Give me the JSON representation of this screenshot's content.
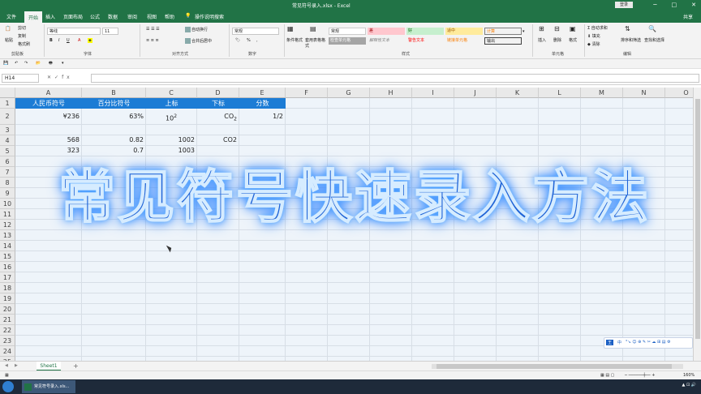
{
  "window": {
    "title": "常见符号录入.xlsx  -  Excel",
    "login": "登录",
    "min": "─",
    "max": "□",
    "close": "✕"
  },
  "ribbon_tabs": [
    "文件",
    "开始",
    "插入",
    "页面布局",
    "公式",
    "数据",
    "审阅",
    "视图",
    "帮助",
    "操作说明搜索"
  ],
  "active_tab": "开始",
  "share_label": "共享",
  "clipboard": {
    "cut": "剪切",
    "copy": "复制",
    "format_painter": "格式刷",
    "group": "剪贴板",
    "paste": "粘贴"
  },
  "font": {
    "name": "等线",
    "size": "11",
    "bold": "B",
    "italic": "I",
    "underline": "U",
    "group": "字体"
  },
  "alignment": {
    "wrap": "自动换行",
    "merge": "合并后居中",
    "group": "对齐方式"
  },
  "number": {
    "format": "常规",
    "percent": "%",
    "comma": ",",
    "group": "数字"
  },
  "styles": {
    "conditional": "条件格式",
    "table": "套用表格格式",
    "group": "样式",
    "cells": [
      "常规",
      "差",
      "好",
      "适中",
      "计算",
      "检查单元格",
      "解释性文本",
      "警告文本",
      "链接单元格",
      "输出"
    ]
  },
  "cells_group": {
    "insert": "插入",
    "delete": "删除",
    "format": "格式",
    "group": "单元格"
  },
  "editing": {
    "autosum": "自动求和",
    "fill": "填充",
    "clear": "清除",
    "sort": "排序和筛选",
    "find": "查找和选择",
    "group": "编辑"
  },
  "formula_bar": {
    "name_box": "H14",
    "fx": "fx",
    "value": ""
  },
  "columns": [
    "A",
    "B",
    "C",
    "D",
    "E",
    "F",
    "G",
    "H",
    "I",
    "J",
    "K",
    "L",
    "M",
    "N",
    "O"
  ],
  "rows": [
    "1",
    "2",
    "3",
    "4",
    "5",
    "6",
    "7",
    "8",
    "9",
    "10",
    "11",
    "12",
    "13",
    "14",
    "15",
    "16",
    "17",
    "18",
    "19",
    "20",
    "21",
    "22",
    "23",
    "24",
    "25"
  ],
  "headers": {
    "a": "人民币符号",
    "b": "百分比符号",
    "c": "上标",
    "d": "下标",
    "e": "分数"
  },
  "row2": {
    "a": "¥236",
    "b": "63%",
    "c_base": "10",
    "c_sup": "2",
    "d_base": "CO",
    "d_sub": "2",
    "e": "1/2"
  },
  "row4": {
    "a": "568",
    "b": "0.82",
    "c": "1002",
    "d": "CO2"
  },
  "row5": {
    "a": "323",
    "b": "0.7",
    "c": "1003"
  },
  "overlay_title": "常见符号快速录入方法",
  "sheet_tab": "Sheet1",
  "add_sheet": "+",
  "status": {
    "zoom": "160%"
  },
  "taskbar": {
    "app": "常见符号录入.xls..."
  },
  "ime_label": "中",
  "colors": {
    "excel_green": "#217346",
    "header_fill": "#1c7cd5",
    "overlay_text": "#1e63d6"
  }
}
